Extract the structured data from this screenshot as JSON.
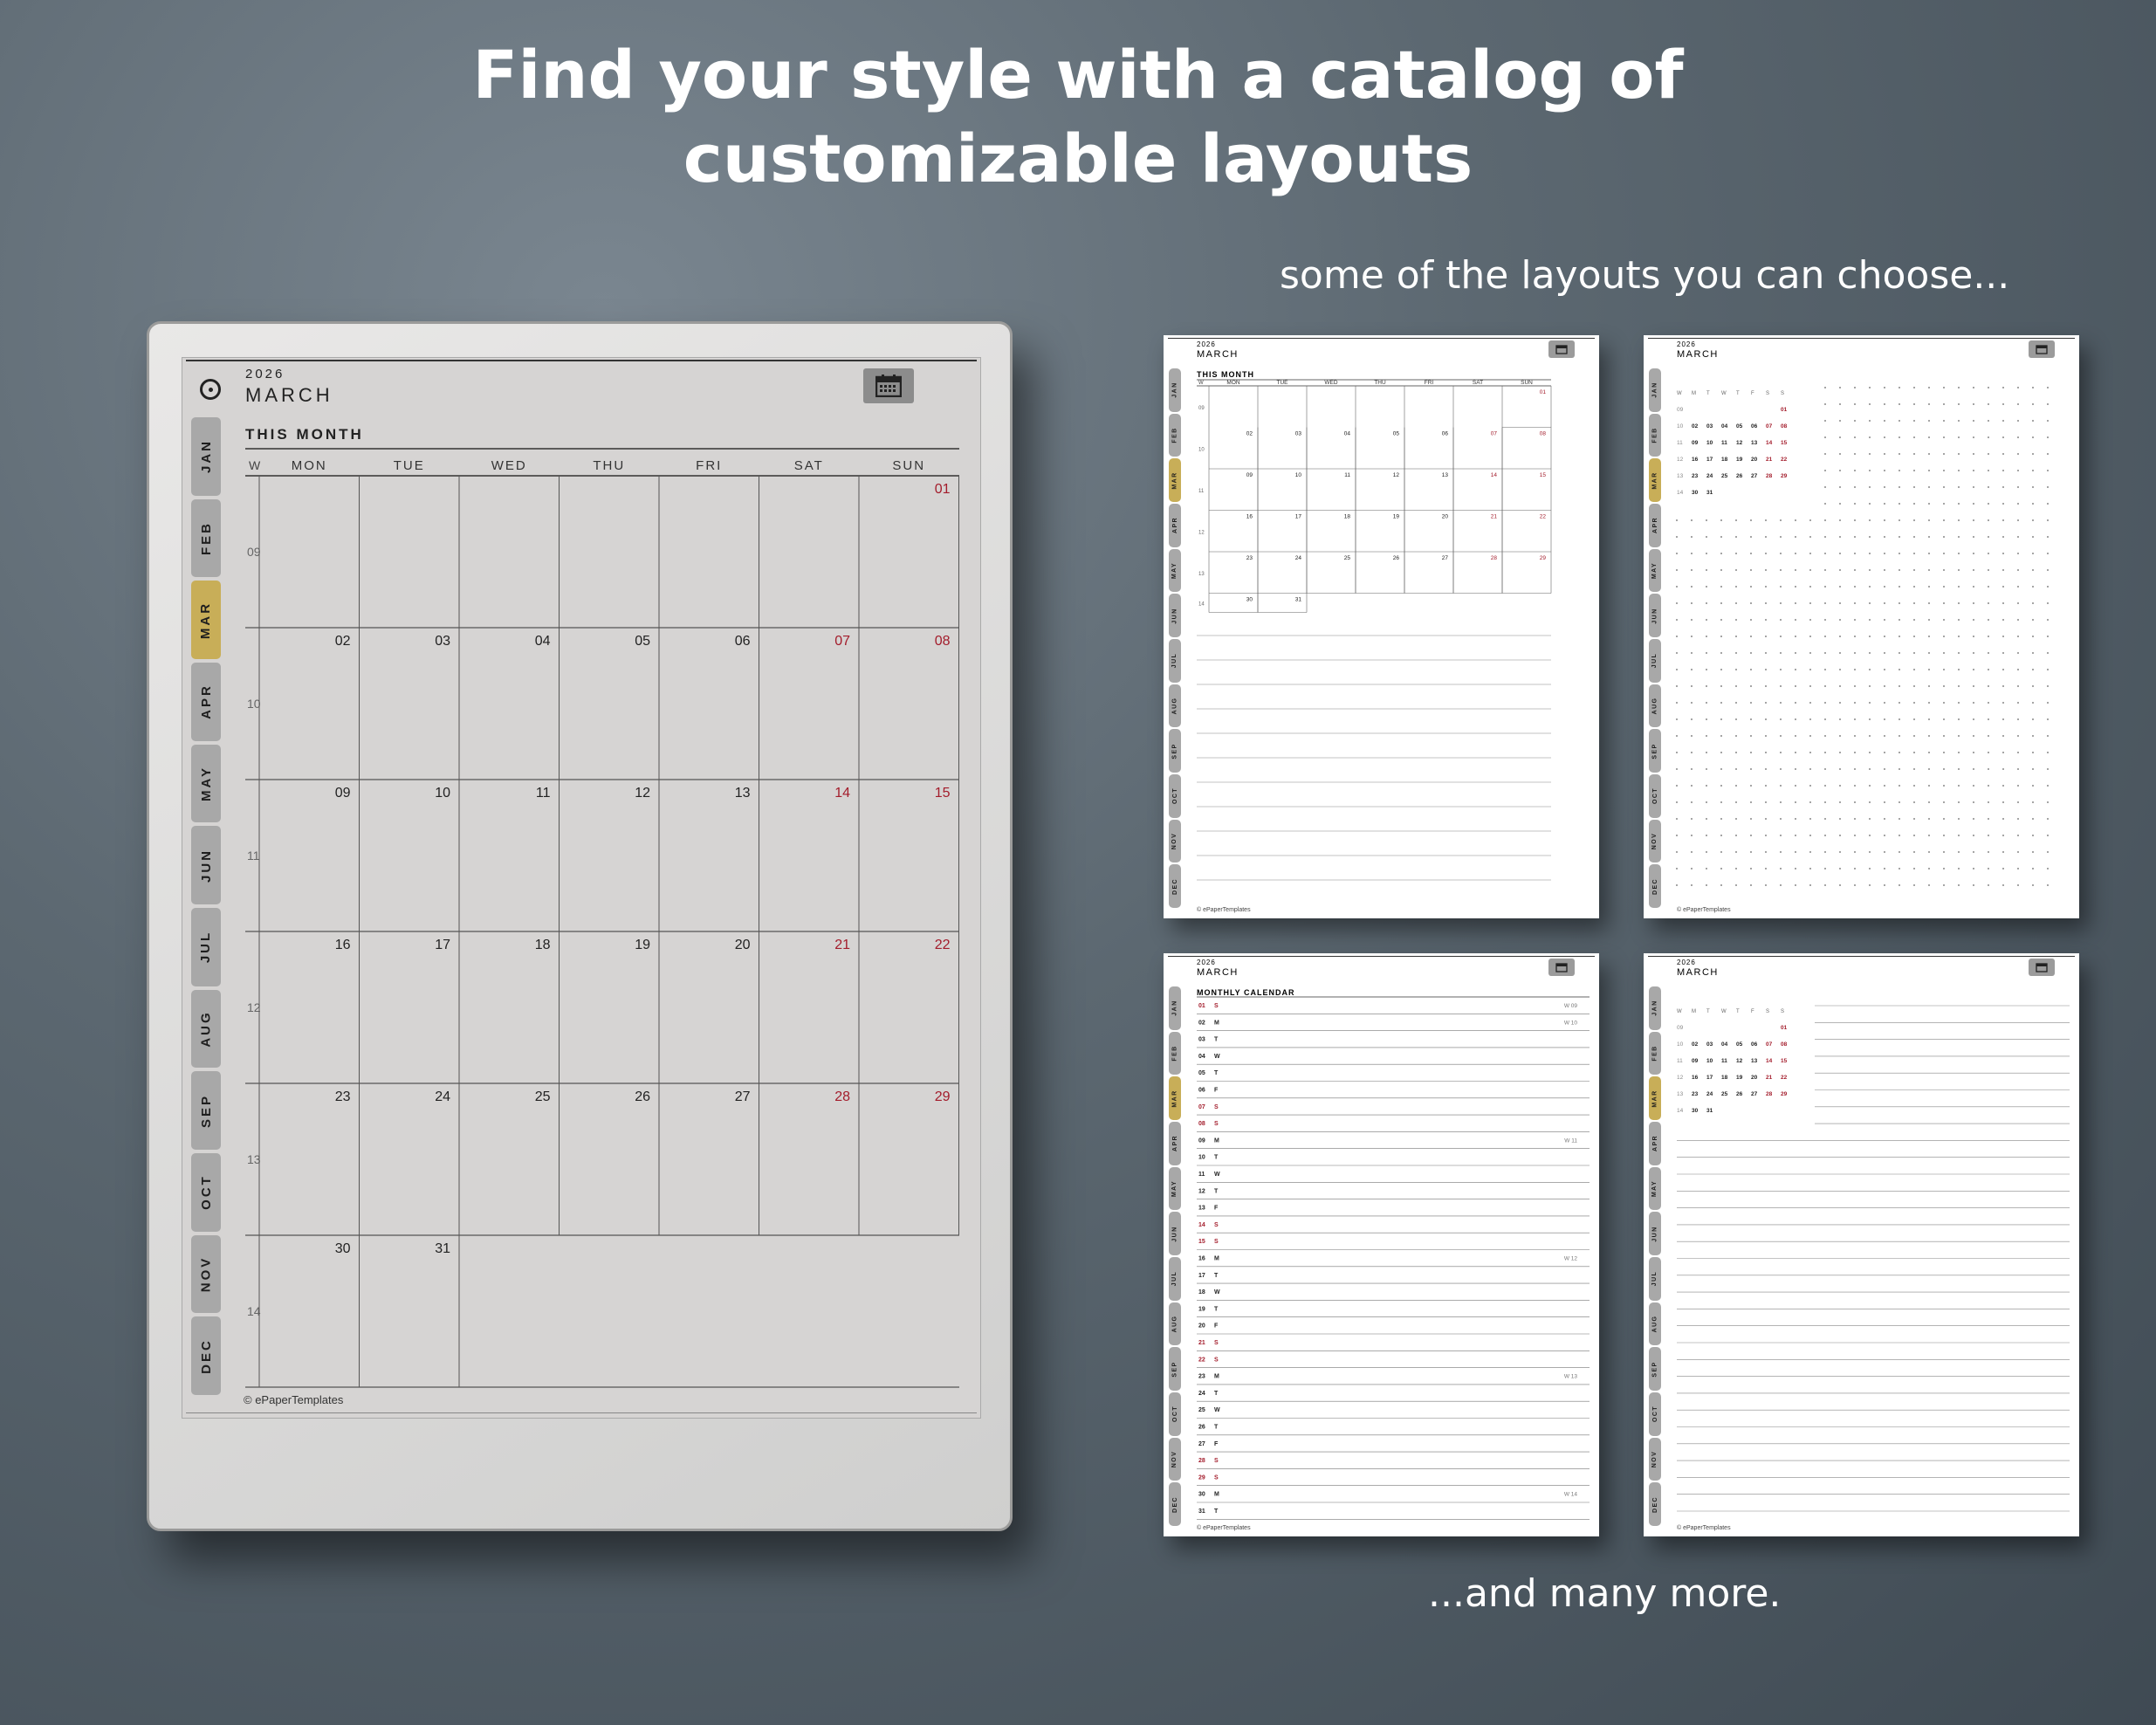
{
  "headline": {
    "line1": "Find your style with a catalog of",
    "line2": "customizable layouts"
  },
  "subline": "some of the layouts you can choose...",
  "footline": "...and many more.",
  "colors": {
    "accent_tab": "#c8ae58",
    "weekend": "#a31c2b",
    "tab": "#a8a8a8"
  },
  "months": [
    "JAN",
    "FEB",
    "MAR",
    "APR",
    "MAY",
    "JUN",
    "JUL",
    "AUG",
    "SEP",
    "OCT",
    "NOV",
    "DEC"
  ],
  "active_month": "MAR",
  "icons": {
    "sync": "sync-icon",
    "calendar": "calendar-icon"
  },
  "device": {
    "year": "2026",
    "month": "MARCH",
    "section_title": "THIS MONTH",
    "week_col_label": "W",
    "weekdays": [
      "MON",
      "TUE",
      "WED",
      "THU",
      "FRI",
      "SAT",
      "SUN"
    ],
    "week_numbers": [
      "09",
      "10",
      "11",
      "12",
      "13",
      "14"
    ],
    "weeks": [
      [
        "",
        "",
        "",
        "",
        "",
        "",
        "01"
      ],
      [
        "02",
        "03",
        "04",
        "05",
        "06",
        "07",
        "08"
      ],
      [
        "09",
        "10",
        "11",
        "12",
        "13",
        "14",
        "15"
      ],
      [
        "16",
        "17",
        "18",
        "19",
        "20",
        "21",
        "22"
      ],
      [
        "23",
        "24",
        "25",
        "26",
        "27",
        "28",
        "29"
      ],
      [
        "30",
        "31",
        "",
        "",
        "",
        "",
        ""
      ]
    ],
    "copyright": "© ePaperTemplates"
  },
  "layouts": [
    {
      "id": "month-grid",
      "year": "2026",
      "month": "MARCH",
      "section_title": "THIS MONTH",
      "copyright": "© ePaperTemplates"
    },
    {
      "id": "mini-calendar-dots",
      "year": "2026",
      "month": "MARCH",
      "copyright": "© ePaperTemplates"
    },
    {
      "id": "monthly-list",
      "year": "2026",
      "month": "MARCH",
      "section_title": "MONTHLY CALENDAR",
      "copyright": "© ePaperTemplates",
      "days": [
        {
          "d": "01",
          "w": "S",
          "wk": "W 09"
        },
        {
          "d": "02",
          "w": "M",
          "wk": "W 10"
        },
        {
          "d": "03",
          "w": "T",
          "wk": ""
        },
        {
          "d": "04",
          "w": "W",
          "wk": ""
        },
        {
          "d": "05",
          "w": "T",
          "wk": ""
        },
        {
          "d": "06",
          "w": "F",
          "wk": ""
        },
        {
          "d": "07",
          "w": "S",
          "wk": ""
        },
        {
          "d": "08",
          "w": "S",
          "wk": ""
        },
        {
          "d": "09",
          "w": "M",
          "wk": "W 11"
        },
        {
          "d": "10",
          "w": "T",
          "wk": ""
        },
        {
          "d": "11",
          "w": "W",
          "wk": ""
        },
        {
          "d": "12",
          "w": "T",
          "wk": ""
        },
        {
          "d": "13",
          "w": "F",
          "wk": ""
        },
        {
          "d": "14",
          "w": "S",
          "wk": ""
        },
        {
          "d": "15",
          "w": "S",
          "wk": ""
        },
        {
          "d": "16",
          "w": "M",
          "wk": "W 12"
        },
        {
          "d": "17",
          "w": "T",
          "wk": ""
        },
        {
          "d": "18",
          "w": "W",
          "wk": ""
        },
        {
          "d": "19",
          "w": "T",
          "wk": ""
        },
        {
          "d": "20",
          "w": "F",
          "wk": ""
        },
        {
          "d": "21",
          "w": "S",
          "wk": ""
        },
        {
          "d": "22",
          "w": "S",
          "wk": ""
        },
        {
          "d": "23",
          "w": "M",
          "wk": "W 13"
        },
        {
          "d": "24",
          "w": "T",
          "wk": ""
        },
        {
          "d": "25",
          "w": "W",
          "wk": ""
        },
        {
          "d": "26",
          "w": "T",
          "wk": ""
        },
        {
          "d": "27",
          "w": "F",
          "wk": ""
        },
        {
          "d": "28",
          "w": "S",
          "wk": ""
        },
        {
          "d": "29",
          "w": "S",
          "wk": ""
        },
        {
          "d": "30",
          "w": "M",
          "wk": "W 14"
        },
        {
          "d": "31",
          "w": "T",
          "wk": ""
        }
      ]
    },
    {
      "id": "mini-calendar-lines",
      "year": "2026",
      "month": "MARCH",
      "copyright": "© ePaperTemplates"
    }
  ],
  "mini_calendar": {
    "header": [
      "W",
      "M",
      "T",
      "W",
      "T",
      "F",
      "S",
      "S"
    ],
    "rows": [
      [
        "09",
        "",
        "",
        "",
        "",
        "",
        "",
        "01"
      ],
      [
        "10",
        "02",
        "03",
        "04",
        "05",
        "06",
        "07",
        "08"
      ],
      [
        "11",
        "09",
        "10",
        "11",
        "12",
        "13",
        "14",
        "15"
      ],
      [
        "12",
        "16",
        "17",
        "18",
        "19",
        "20",
        "21",
        "22"
      ],
      [
        "13",
        "23",
        "24",
        "25",
        "26",
        "27",
        "28",
        "29"
      ],
      [
        "14",
        "30",
        "31",
        "",
        "",
        "",
        "",
        ""
      ]
    ]
  }
}
